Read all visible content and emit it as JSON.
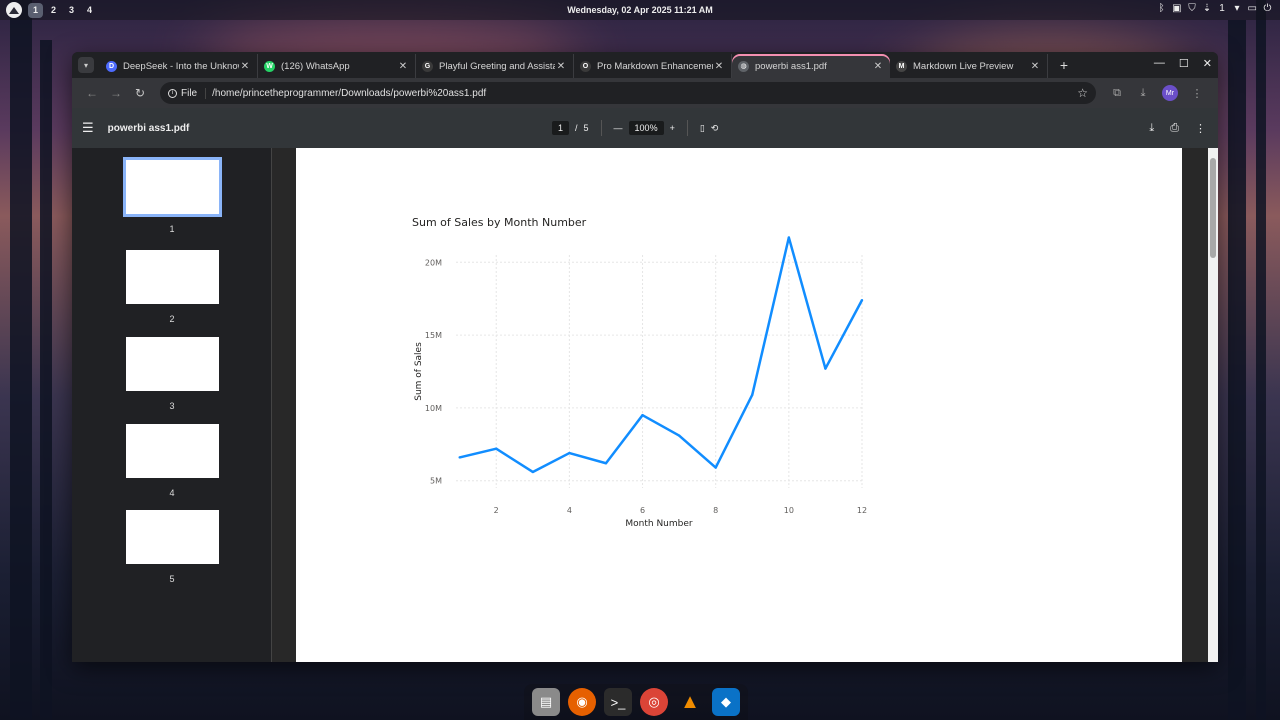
{
  "desktop": {
    "workspaces": [
      "1",
      "2",
      "3",
      "4"
    ],
    "active_workspace": "1",
    "clock": "Wednesday, 02 Apr 2025 11:21 AM",
    "tray_battery": "1",
    "dock": [
      "files",
      "firefox",
      "terminal",
      "chrome",
      "vlc",
      "vscode"
    ]
  },
  "browser": {
    "tabs": [
      {
        "title": "DeepSeek - Into the Unknown",
        "icon": "deepseek-icon",
        "color": "#4d6bfe",
        "glyph": "D"
      },
      {
        "title": "(126) WhatsApp",
        "icon": "whatsapp-icon",
        "color": "#25d366",
        "glyph": "W"
      },
      {
        "title": "Playful Greeting and Assistance",
        "icon": "github-icon",
        "color": "#3a3a3a",
        "glyph": "G"
      },
      {
        "title": "Pro Markdown Enhancements",
        "icon": "openai-icon",
        "color": "#3a3a3a",
        "glyph": "O"
      },
      {
        "title": "powerbi ass1.pdf",
        "icon": "globe-icon",
        "color": "#5f6368",
        "glyph": "◍"
      },
      {
        "title": "Markdown Live Preview",
        "icon": "markdown-icon",
        "color": "#444",
        "glyph": "M"
      }
    ],
    "active_tab": 4,
    "address_chip": "File",
    "url": "/home/princetheprogrammer/Downloads/powerbi%20ass1.pdf",
    "profile_initials": "Mr"
  },
  "pdf": {
    "title": "powerbi ass1.pdf",
    "page_current": "1",
    "page_sep": "/",
    "page_total": "5",
    "zoom": "100%",
    "thumbnails": [
      "1",
      "2",
      "3",
      "4",
      "5"
    ]
  },
  "chart_data": {
    "type": "line",
    "title": "Sum of Sales by Month Number",
    "xlabel": "Month Number",
    "ylabel": "Sum of Sales",
    "x": [
      1,
      2,
      3,
      4,
      5,
      6,
      7,
      8,
      9,
      10,
      11,
      12
    ],
    "series": [
      {
        "values": [
          6.6,
          7.2,
          5.6,
          6.9,
          6.2,
          9.5,
          8.1,
          5.9,
          10.9,
          21.7,
          12.7,
          17.4
        ],
        "color": "#118dff"
      }
    ],
    "x_ticks": [
      2,
      4,
      6,
      8,
      10,
      12
    ],
    "x_tick_labels": [
      "2",
      "4",
      "6",
      "8",
      "10",
      "12"
    ],
    "y_ticks": [
      5,
      10,
      15,
      20
    ],
    "y_tick_labels": [
      "5M",
      "10M",
      "15M",
      "20M"
    ],
    "y_unit": "M",
    "xlim": [
      0.9,
      12
    ],
    "ylim": [
      4.5,
      20.5
    ],
    "grid": true
  }
}
